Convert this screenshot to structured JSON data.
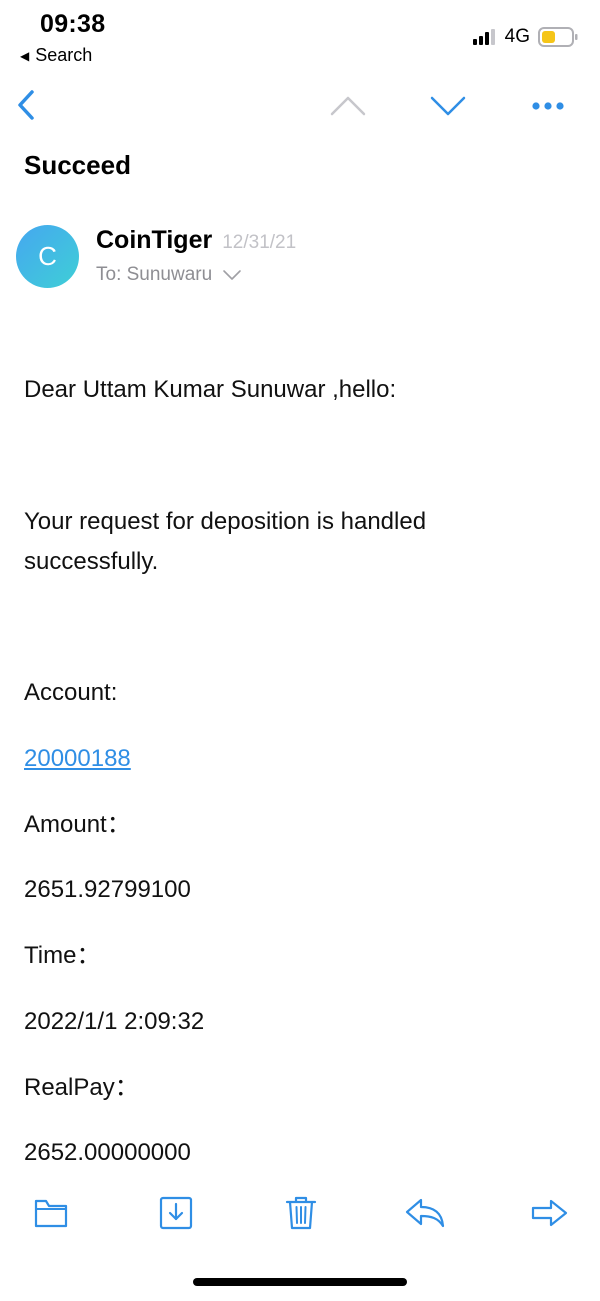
{
  "status_bar": {
    "time": "09:38",
    "back_label": "Search",
    "network": "4G",
    "battery_color": "#f5c518"
  },
  "nav": {
    "back_icon": "chevron-left-icon",
    "prev_icon": "chevron-up-icon",
    "next_icon": "chevron-down-icon",
    "more_icon": "more-icon",
    "accent": "#2f8ee5"
  },
  "email": {
    "subject": "Succeed",
    "sender": {
      "initial": "C",
      "name": "CoinTiger",
      "date": "12/31/21",
      "to": "To: Sunuwaru"
    },
    "greeting": "Dear Uttam Kumar Sunuwar ,hello:",
    "message": "Your request for deposition is handled successfully.",
    "fields": {
      "account_label": "Account:",
      "account_value": "20000188",
      "amount_label": "Amount：",
      "amount_value": "2651.92799100",
      "time_label": "Time：",
      "time_value": "2022/1/1 2:09:32",
      "realpay_label": "RealPay：",
      "realpay_value": "2652.00000000"
    }
  },
  "toolbar": {
    "icons": [
      "folder-icon",
      "archive-icon",
      "trash-icon",
      "reply-icon",
      "forward-icon"
    ]
  }
}
